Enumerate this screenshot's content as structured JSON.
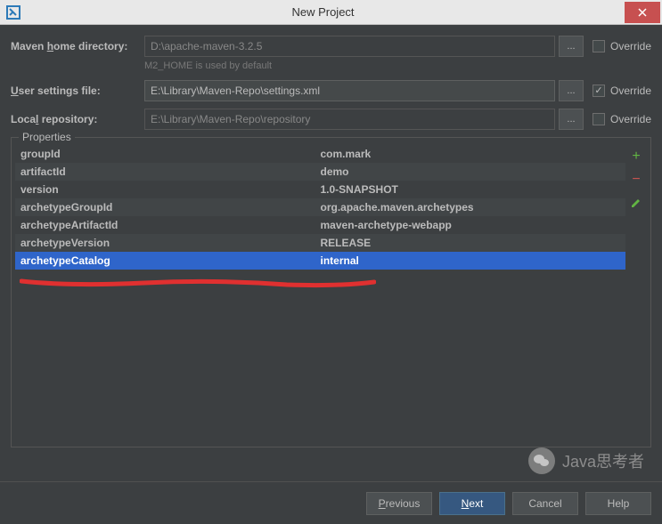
{
  "window": {
    "title": "New Project"
  },
  "form": {
    "mavenHome": {
      "label_pre": "Maven ",
      "label_ul": "h",
      "label_post": "ome directory:",
      "value": "D:\\apache-maven-3.2.5",
      "override_label": "Override"
    },
    "hint": "M2_HOME is used by default",
    "userSettings": {
      "label_ul": "U",
      "label_post": "ser settings file:",
      "value": "E:\\Library\\Maven-Repo\\settings.xml",
      "override_label": "Override"
    },
    "localRepo": {
      "label_pre": "Loca",
      "label_ul": "l",
      "label_post": " repository:",
      "value": "E:\\Library\\Maven-Repo\\repository",
      "override_label": "Override"
    }
  },
  "properties": {
    "title": "Properties",
    "rows": [
      {
        "key": "groupId",
        "val": "com.mark"
      },
      {
        "key": "artifactId",
        "val": "demo"
      },
      {
        "key": "version",
        "val": "1.0-SNAPSHOT"
      },
      {
        "key": "archetypeGroupId",
        "val": "org.apache.maven.archetypes"
      },
      {
        "key": "archetypeArtifactId",
        "val": "maven-archetype-webapp"
      },
      {
        "key": "archetypeVersion",
        "val": "RELEASE"
      },
      {
        "key": "archetypeCatalog",
        "val": "internal"
      }
    ],
    "selected_index": 6
  },
  "watermark": "Java思考者",
  "buttons": {
    "previous_ul": "P",
    "previous_post": "revious",
    "next_ul": "N",
    "next_post": "ext",
    "cancel": "Cancel",
    "help": "Help"
  }
}
